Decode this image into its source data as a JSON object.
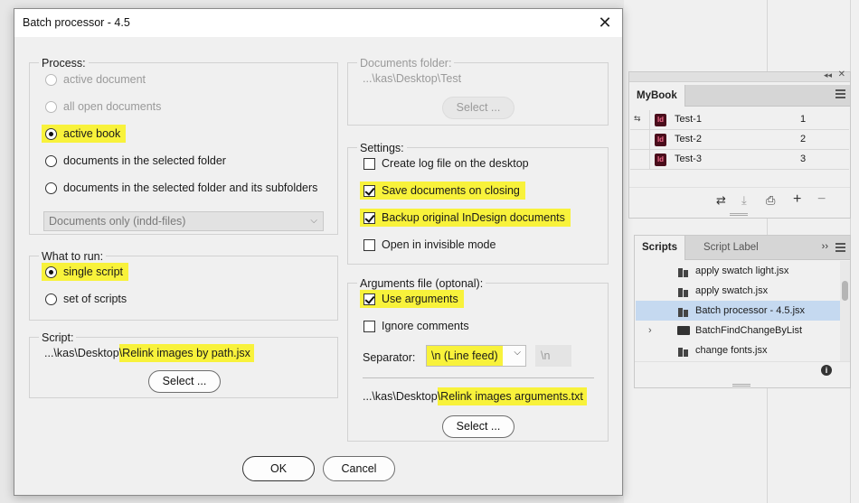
{
  "dialog": {
    "title": "Batch processor - 4.5",
    "close_glyph": "✕",
    "process": {
      "label": "Process:",
      "options": [
        "active document",
        "all open documents",
        "active book",
        "documents in the selected folder",
        "documents in the selected folder and its subfolders"
      ],
      "selected": "active book",
      "filter_dropdown": "Documents only (indd-files)"
    },
    "what_to_run": {
      "label": "What to run:",
      "options": [
        "single script",
        "set of scripts"
      ],
      "selected": "single script"
    },
    "script": {
      "label": "Script:",
      "path_prefix": "...\\kas\\Desktop",
      "path_file": "\\Relink images by path.jsx",
      "select_label": "Select ..."
    },
    "documents_folder": {
      "label": "Documents folder:",
      "path": "...\\kas\\Desktop\\Test",
      "select_label": "Select ..."
    },
    "settings": {
      "label": "Settings:",
      "options": [
        {
          "label": "Create log file on the desktop",
          "checked": false
        },
        {
          "label": "Save documents on closing",
          "checked": true
        },
        {
          "label": "Backup original InDesign documents",
          "checked": true
        },
        {
          "label": "Open in invisible mode",
          "checked": false
        }
      ]
    },
    "arguments": {
      "label": "Arguments file (optonal):",
      "use_arguments": "Use arguments",
      "ignore_comments": "Ignore comments",
      "separator_label": "Separator:",
      "separator_value": "\\n (Line feed)",
      "separator_preview": "\\n",
      "path_prefix": "...\\kas\\Desktop",
      "path_file": "\\Relink images arguments.txt",
      "select_label": "Select ..."
    },
    "ok_label": "OK",
    "cancel_label": "Cancel"
  },
  "mybook_panel": {
    "collapse_glyph": "◂◂",
    "close_glyph": "✕",
    "tab": "MyBook",
    "rows": [
      {
        "name": "Test-1",
        "page": "1"
      },
      {
        "name": "Test-2",
        "page": "2"
      },
      {
        "name": "Test-3",
        "page": "3"
      }
    ],
    "id_badge": "Id",
    "sync_glyph": "⇆",
    "footer_icons": [
      "⇄",
      "⤓",
      "⎙",
      "+",
      "−"
    ]
  },
  "scripts_panel": {
    "tabs": [
      "Scripts",
      "Script Label"
    ],
    "overflow_glyph": "››",
    "items": [
      {
        "name": "apply swatch light.jsx",
        "type": "script"
      },
      {
        "name": "apply swatch.jsx",
        "type": "script"
      },
      {
        "name": "Batch processor - 4.5.jsx",
        "type": "script",
        "selected": true
      },
      {
        "name": "BatchFindChangeByList",
        "type": "folder"
      },
      {
        "name": "change fonts.jsx",
        "type": "script"
      }
    ],
    "expand_glyph": "›",
    "info_glyph": "i"
  },
  "colors": {
    "highlight": "#f8f23b",
    "selection": "#c5d9f0",
    "indesign_badge": "#4a0e1c"
  }
}
